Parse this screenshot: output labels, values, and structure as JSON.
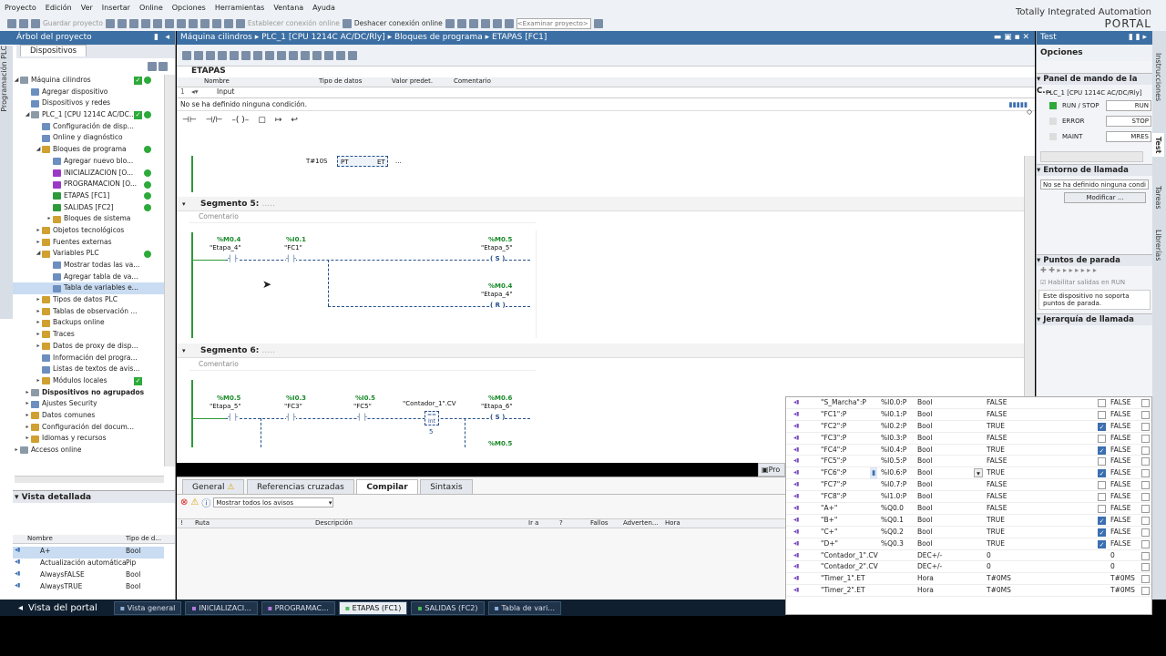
{
  "menu": [
    "Proyecto",
    "Edición",
    "Ver",
    "Insertar",
    "Online",
    "Opciones",
    "Herramientas",
    "Ventana",
    "Ayuda"
  ],
  "toolbar": {
    "save": "Guardar proyecto",
    "connect": "Establecer conexión online",
    "disconnect": "Deshacer conexión online",
    "search_placeholder": "<Examinar proyecto>"
  },
  "brand": {
    "line1": "Totally Integrated Automation",
    "line2": "PORTAL"
  },
  "left_vtab": "Programación PLC",
  "tree": {
    "title": "Árbol del proyecto",
    "tab": "Dispositivos",
    "items": [
      {
        "label": "Máquina cilindros",
        "indent": 0,
        "open": true,
        "icon": "grey",
        "chk": true,
        "stat": true
      },
      {
        "label": "Agregar dispositivo",
        "indent": 1,
        "icon": "blue"
      },
      {
        "label": "Dispositivos y redes",
        "indent": 1,
        "icon": "blue"
      },
      {
        "label": "PLC_1 [CPU 1214C AC/DC...",
        "indent": 1,
        "open": true,
        "icon": "grey",
        "chk": true,
        "stat": true
      },
      {
        "label": "Configuración de disp...",
        "indent": 2,
        "icon": "blue"
      },
      {
        "label": "Online y diagnóstico",
        "indent": 2,
        "icon": "blue"
      },
      {
        "label": "Bloques de programa",
        "indent": 2,
        "open": true,
        "icon": "yellow",
        "stat": true
      },
      {
        "label": "Agregar nuevo blo...",
        "indent": 3,
        "icon": "blue"
      },
      {
        "label": "INICIALIZACION [O...",
        "indent": 3,
        "icon": "purple",
        "stat": true
      },
      {
        "label": "PROGRAMACION [O...",
        "indent": 3,
        "icon": "purple",
        "stat": true
      },
      {
        "label": "ETAPAS [FC1]",
        "indent": 3,
        "icon": "green",
        "stat": true
      },
      {
        "label": "SALIDAS [FC2]",
        "indent": 3,
        "icon": "green",
        "stat": true
      },
      {
        "label": "Bloques de sistema",
        "indent": 3,
        "closed": true,
        "icon": "yellow"
      },
      {
        "label": "Objetos tecnológicos",
        "indent": 2,
        "closed": true,
        "icon": "yellow"
      },
      {
        "label": "Fuentes externas",
        "indent": 2,
        "closed": true,
        "icon": "yellow"
      },
      {
        "label": "Variables PLC",
        "indent": 2,
        "open": true,
        "icon": "yellow",
        "stat": true
      },
      {
        "label": "Mostrar todas las va...",
        "indent": 3,
        "icon": "blue"
      },
      {
        "label": "Agregar tabla de va...",
        "indent": 3,
        "icon": "blue"
      },
      {
        "label": "Tabla de variables e...",
        "indent": 3,
        "icon": "blue",
        "selected": true
      },
      {
        "label": "Tipos de datos PLC",
        "indent": 2,
        "closed": true,
        "icon": "yellow"
      },
      {
        "label": "Tablas de observación ...",
        "indent": 2,
        "closed": true,
        "icon": "yellow"
      },
      {
        "label": "Backups online",
        "indent": 2,
        "closed": true,
        "icon": "yellow"
      },
      {
        "label": "Traces",
        "indent": 2,
        "closed": true,
        "icon": "yellow"
      },
      {
        "label": "Datos de proxy de disp...",
        "indent": 2,
        "closed": true,
        "icon": "yellow"
      },
      {
        "label": "Información del progra...",
        "indent": 2,
        "icon": "blue"
      },
      {
        "label": "Listas de textos de avis...",
        "indent": 2,
        "icon": "blue"
      },
      {
        "label": "Módulos locales",
        "indent": 2,
        "closed": true,
        "icon": "yellow",
        "chk": true
      },
      {
        "label": "Dispositivos no agrupados",
        "indent": 1,
        "closed": true,
        "icon": "grey",
        "hl": true
      },
      {
        "label": "Ajustes Security",
        "indent": 1,
        "closed": true,
        "icon": "blue"
      },
      {
        "label": "Datos comunes",
        "indent": 1,
        "closed": true,
        "icon": "yellow"
      },
      {
        "label": "Configuración del docum...",
        "indent": 1,
        "closed": true,
        "icon": "yellow"
      },
      {
        "label": "Idiomas y recursos",
        "indent": 1,
        "closed": true,
        "icon": "yellow"
      },
      {
        "label": "Accesos online",
        "indent": 0,
        "closed": true,
        "icon": "grey"
      }
    ]
  },
  "detail": {
    "title": "Vista detallada",
    "col_name": "Nombre",
    "col_type": "Tipo de d...",
    "rows": [
      [
        "A+",
        "Bool"
      ],
      [
        "Actualización automática",
        "Pip"
      ],
      [
        "AlwaysFALSE",
        "Bool"
      ],
      [
        "AlwaysTRUE",
        "Bool"
      ]
    ]
  },
  "editor": {
    "breadcrumb": "Máquina cilindros  ▸  PLC_1 [CPU 1214C AC/DC/Rly]  ▸  Bloques de programa  ▸  ETAPAS [FC1]",
    "block_name": "ETAPAS",
    "iface_cols": [
      "Nombre",
      "Tipo de datos",
      "Valor predet.",
      "Comentario"
    ],
    "iface_row_num": "1",
    "iface_row": "Input",
    "condition": "No se ha definido ninguna condición.",
    "timer_pt": "T#10S",
    "timer_pt_label": "PT",
    "timer_et_label": "ET",
    "timer_dots": "...",
    "seg5": {
      "title": "Segmento 5:",
      "dots": ".....",
      "comment": "Comentario",
      "c1_addr": "%M0.4",
      "c1_name": "\"Etapa_4\"",
      "c2_addr": "%I0.1",
      "c2_name": "\"FC1\"",
      "s_addr": "%M0.5",
      "s_name": "\"Etapa_5\"",
      "s": "S",
      "r_addr": "%M0.4",
      "r_name": "\"Etapa_4\"",
      "r": "R"
    },
    "seg6": {
      "title": "Segmento 6:",
      "dots": ".....",
      "comment": "Comentario",
      "c1_addr": "%M0.5",
      "c1_name": "\"Etapa_5\"",
      "c2_addr": "%I0.3",
      "c2_name": "\"FC3\"",
      "c3_addr": "%I0.5",
      "c3_name": "\"FC5\"",
      "cmp_name": "\"Contador_1\".CV",
      "cmp_op": "==",
      "cmp_type": "Int",
      "cmp_val": "5",
      "s_addr": "%M0.6",
      "s_name": "\"Etapa_6\"",
      "s": "S",
      "next_addr": "%M0.5"
    }
  },
  "bottom": {
    "tabs": [
      "General",
      "Referencias cruzadas",
      "Compilar",
      "Sintaxis"
    ],
    "active": "Compilar",
    "filter": "Mostrar todos los avisos",
    "cols": [
      "!",
      "Ruta",
      "Descripción",
      "Ir a",
      "?",
      "Fallos",
      "Adverten...",
      "Hora"
    ],
    "pro_tab": "Pro"
  },
  "right": {
    "title": "Test",
    "options": "Opciones",
    "panel": "Panel de mando de la C...",
    "cpu": "PLC_1 [CPU 1214C AC/DC/Rly]",
    "rows": [
      [
        "RUN / STOP",
        "RUN"
      ],
      [
        "ERROR",
        "STOP"
      ],
      [
        "MAINT",
        "MRES"
      ]
    ],
    "env_title": "Entorno de llamada",
    "env_cond": "No se ha definido ninguna condi",
    "modify": "Modificar ...",
    "bp_title": "Puntos de parada",
    "bp_enable": "Habilitar salidas en RUN",
    "bp_note": "Este dispositivo no soporta puntos de parada.",
    "hier_title": "Jerarquía de llamada"
  },
  "right_vtabs": [
    "Instrucciones",
    "Test",
    "Tareas",
    "Librerías"
  ],
  "watch": [
    [
      "\"S_Marcha\":P",
      "%I0.0:P",
      "Bool",
      "FALSE",
      false,
      "FALSE"
    ],
    [
      "\"FC1\":P",
      "%I0.1:P",
      "Bool",
      "FALSE",
      false,
      "FALSE"
    ],
    [
      "\"FC2\":P",
      "%I0.2:P",
      "Bool",
      "TRUE",
      true,
      "FALSE"
    ],
    [
      "\"FC3\":P",
      "%I0.3:P",
      "Bool",
      "FALSE",
      false,
      "FALSE"
    ],
    [
      "\"FC4\":P",
      "%I0.4:P",
      "Bool",
      "TRUE",
      true,
      "FALSE"
    ],
    [
      "\"FC5\":P",
      "%I0.5:P",
      "Bool",
      "FALSE",
      false,
      "FALSE"
    ],
    [
      "\"FC6\":P",
      "%I0.6:P",
      "Bool",
      "TRUE",
      true,
      "FALSE"
    ],
    [
      "\"FC7\":P",
      "%I0.7:P",
      "Bool",
      "FALSE",
      false,
      "FALSE"
    ],
    [
      "\"FC8\":P",
      "%I1.0:P",
      "Bool",
      "FALSE",
      false,
      "FALSE"
    ],
    [
      "\"A+\"",
      "%Q0.0",
      "Bool",
      "FALSE",
      false,
      "FALSE"
    ],
    [
      "\"B+\"",
      "%Q0.1",
      "Bool",
      "TRUE",
      true,
      "FALSE"
    ],
    [
      "\"C+\"",
      "%Q0.2",
      "Bool",
      "TRUE",
      true,
      "FALSE"
    ],
    [
      "\"D+\"",
      "%Q0.3",
      "Bool",
      "TRUE",
      true,
      "FALSE"
    ],
    [
      "\"Contador_1\".CV",
      "",
      "DEC+/-",
      "0",
      null,
      "0"
    ],
    [
      "\"Contador_2\".CV",
      "",
      "DEC+/-",
      "0",
      null,
      "0"
    ],
    [
      "\"Timer_1\".ET",
      "",
      "Hora",
      "T#0MS",
      null,
      "T#0MS"
    ],
    [
      "\"Timer_2\".ET",
      "",
      "Hora",
      "T#0MS",
      null,
      "T#0MS"
    ]
  ],
  "taskbar": {
    "portal": "Vista del portal",
    "tasks": [
      "Vista general",
      "INICIALIZACI...",
      "PROGRAMAC...",
      "ETAPAS (FC1)",
      "SALIDAS (FC2)",
      "Tabla de vari..."
    ],
    "active": "ETAPAS (FC1)"
  }
}
